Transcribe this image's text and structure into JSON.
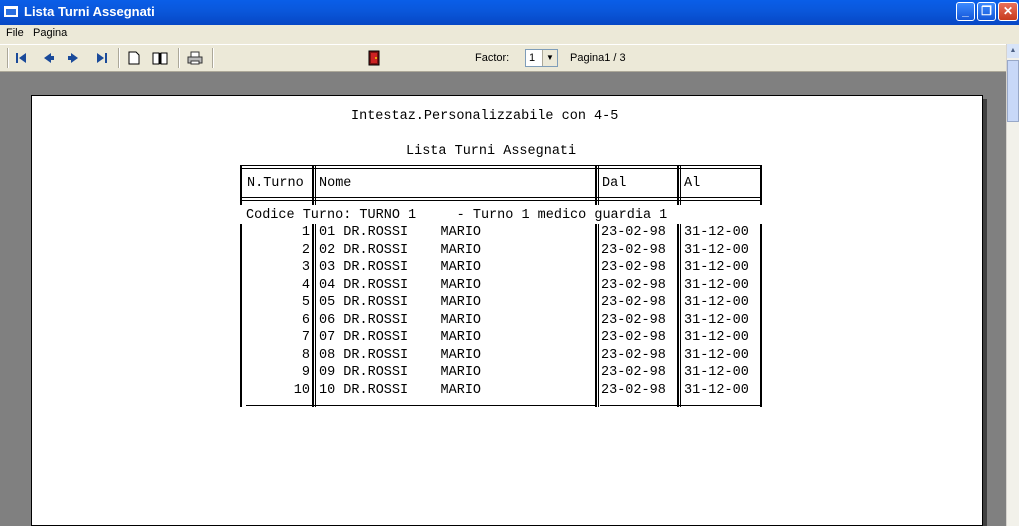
{
  "window": {
    "title": "Lista Turni Assegnati"
  },
  "menu": {
    "items": [
      "File",
      "Pagina"
    ]
  },
  "toolbar": {
    "buttons": [
      "first-page-icon",
      "prev-page-icon",
      "next-page-icon",
      "last-page-icon",
      "single-page-icon",
      "two-pages-icon",
      "print-icon",
      "exit-door-icon"
    ],
    "factor_label": "Factor:",
    "factor_value": "1",
    "page_label": "Pagina1 / 3"
  },
  "report": {
    "header": "Intestaz.Personalizzabile con 4-5",
    "title": "Lista Turni Assegnati",
    "columns": [
      "N.Turno",
      "Nome",
      "Dal",
      "Al"
    ],
    "group_label": "Codice Turno: TURNO 1     - Turno 1 medico guardia 1",
    "rows": [
      {
        "n": "1",
        "nome": "01 DR.ROSSI    MARIO",
        "dal": "23-02-98",
        "al": "31-12-00"
      },
      {
        "n": "2",
        "nome": "02 DR.ROSSI    MARIO",
        "dal": "23-02-98",
        "al": "31-12-00"
      },
      {
        "n": "3",
        "nome": "03 DR.ROSSI    MARIO",
        "dal": "23-02-98",
        "al": "31-12-00"
      },
      {
        "n": "4",
        "nome": "04 DR.ROSSI    MARIO",
        "dal": "23-02-98",
        "al": "31-12-00"
      },
      {
        "n": "5",
        "nome": "05 DR.ROSSI    MARIO",
        "dal": "23-02-98",
        "al": "31-12-00"
      },
      {
        "n": "6",
        "nome": "06 DR.ROSSI    MARIO",
        "dal": "23-02-98",
        "al": "31-12-00"
      },
      {
        "n": "7",
        "nome": "07 DR.ROSSI    MARIO",
        "dal": "23-02-98",
        "al": "31-12-00"
      },
      {
        "n": "8",
        "nome": "08 DR.ROSSI    MARIO",
        "dal": "23-02-98",
        "al": "31-12-00"
      },
      {
        "n": "9",
        "nome": "09 DR.ROSSI    MARIO",
        "dal": "23-02-98",
        "al": "31-12-00"
      },
      {
        "n": "10",
        "nome": "10 DR.ROSSI    MARIO",
        "dal": "23-02-98",
        "al": "31-12-00"
      }
    ]
  },
  "colors": {
    "titlebar": "#0a58dc",
    "chrome": "#ece9d8",
    "canvas": "#808080"
  }
}
